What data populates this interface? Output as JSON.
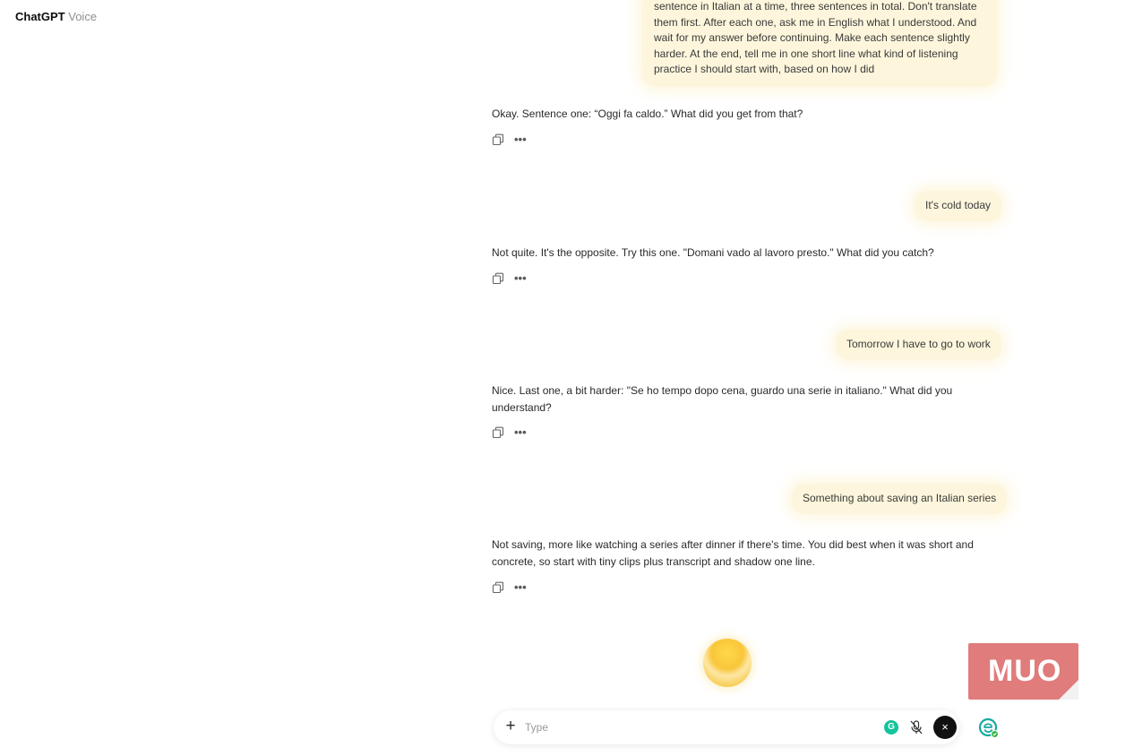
{
  "app": {
    "title": "ChatGPT",
    "subtitle": "Voice"
  },
  "messages": {
    "user_1": "sentence in Italian at a time, three sentences in total. Don't translate them first. After each one, ask me in English what I understood. And wait for my answer before continuing. Make each sentence slightly harder. At the end, tell me in one short line what kind of listening practice I should start with, based on how I did",
    "assistant_1": "Okay. Sentence one: “Oggi fa caldo.” What did you get from that?",
    "user_2": "It's cold today",
    "assistant_2": "Not quite. It's the opposite. Try this one. \"Domani vado al lavoro presto.\" What did you catch?",
    "user_3": "Tomorrow I have to go to work",
    "assistant_3": "Nice. Last one, a bit harder: \"Se ho tempo dopo cena, guardo una serie in italiano.\" What did you understand?",
    "user_4": "Something about saving an Italian series",
    "assistant_4": "Not saving, more like watching a series after dinner if there's time. You did best when it was short and concrete, so start with tiny clips plus transcript and shadow one line."
  },
  "actions": {
    "more_label": "•••"
  },
  "input": {
    "placeholder": "Type",
    "plus_label": "+",
    "close_label": "×"
  },
  "watermark": {
    "text": "MUO"
  },
  "colors": {
    "user_bubble": "#fdf6dc",
    "orb": "#f9c63a",
    "watermark": "#e07c7c"
  },
  "icons": [
    "copy-icon",
    "more-icon",
    "plus-icon",
    "grammarly-icon",
    "mic-off-icon",
    "close-icon",
    "extension-icon"
  ]
}
